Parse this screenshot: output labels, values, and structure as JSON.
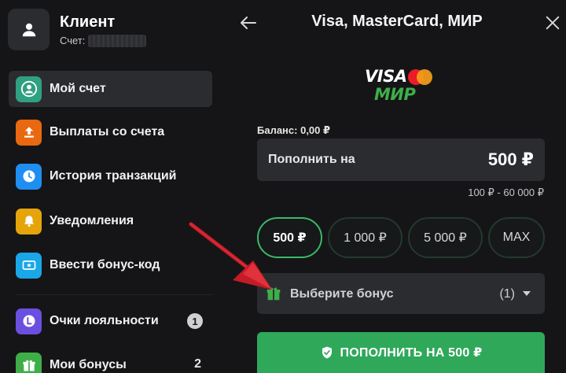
{
  "profile": {
    "name": "Клиент",
    "account_label": "Счет:"
  },
  "menu": {
    "items": [
      {
        "label": "Мой счет",
        "icon": "user-circle-icon",
        "color": "#2fa082",
        "active": true
      },
      {
        "label": "Выплаты со счета",
        "icon": "upload-icon",
        "color": "#e8690f"
      },
      {
        "label": "История транзакций",
        "icon": "clock-icon",
        "color": "#1f8ef1"
      },
      {
        "label": "Уведомления",
        "icon": "bell-icon",
        "color": "#e5a50a"
      },
      {
        "label": "Ввести бонус-код",
        "icon": "ticket-icon",
        "color": "#1aa7e8"
      },
      {
        "label": "Очки лояльности",
        "icon": "loyalty-icon",
        "color": "#6b4fe0",
        "badge": "1"
      },
      {
        "label": "Мои бонусы",
        "icon": "gift-icon",
        "color": "#3fae49",
        "count": "2"
      }
    ]
  },
  "panel": {
    "title": "Visa, MasterCard, МИР",
    "logos": {
      "visa": "VISA",
      "mir": "МИР"
    },
    "balance": "Баланс: 0,00 ₽",
    "amount_label": "Пополнить на",
    "amount_value": "500 ₽",
    "range": "100 ₽ - 60 000 ₽",
    "chips": [
      "500 ₽",
      "1 000 ₽",
      "5 000 ₽",
      "MAX"
    ],
    "selected_chip": 0,
    "bonus_label": "Выберите бонус",
    "bonus_count": "(1)",
    "submit_label": "ПОПОЛНИТЬ НА 500 ₽"
  },
  "colors": {
    "accent_green": "#2fa85a",
    "chip_selected_border": "#3cb86a",
    "annotation_arrow": "#d11f2a"
  }
}
